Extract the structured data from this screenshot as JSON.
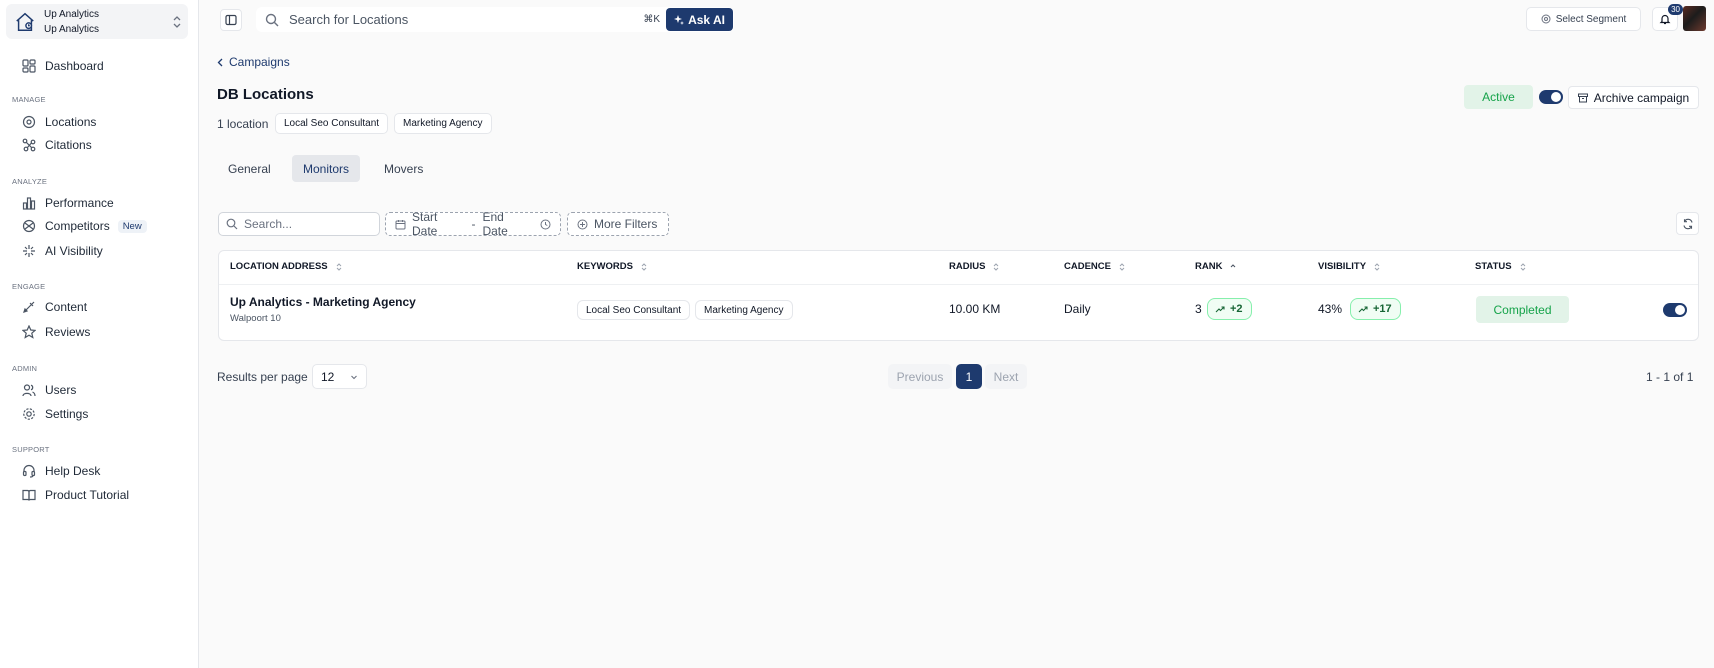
{
  "org": {
    "name": "Up Analytics",
    "subname": "Up Analytics"
  },
  "sidebar": {
    "dashboard": "Dashboard",
    "sections": {
      "manage": "MANAGE",
      "analyze": "ANALYZE",
      "engage": "ENGAGE",
      "admin": "ADMIN",
      "support": "SUPPORT"
    },
    "items": {
      "locations": "Locations",
      "citations": "Citations",
      "performance": "Performance",
      "competitors": "Competitors",
      "competitors_badge": "New",
      "ai_visibility": "AI Visibility",
      "content": "Content",
      "reviews": "Reviews",
      "users": "Users",
      "settings": "Settings",
      "help_desk": "Help Desk",
      "product_tutorial": "Product Tutorial"
    }
  },
  "topbar": {
    "search_placeholder": "Search for Locations",
    "shortcut": "⌘K",
    "ask_ai": "Ask AI",
    "select_segment": "Select Segment",
    "notification_count": "30"
  },
  "breadcrumb": {
    "back_label": "Campaigns"
  },
  "campaign": {
    "title": "DB Locations",
    "location_count": "1 location",
    "keywords": [
      "Local Seo Consultant",
      "Marketing Agency"
    ],
    "status": "Active",
    "archive_label": "Archive campaign"
  },
  "tabs": [
    "General",
    "Monitors",
    "Movers"
  ],
  "filters": {
    "search_placeholder": "Search...",
    "start_date": "Start Date",
    "date_sep": "-",
    "end_date": "End Date",
    "more_filters": "More Filters"
  },
  "table": {
    "headers": [
      "LOCATION ADDRESS",
      "KEYWORDS",
      "RADIUS",
      "CADENCE",
      "RANK",
      "VISIBILITY",
      "STATUS"
    ],
    "rows": [
      {
        "name": "Up Analytics - Marketing Agency",
        "address": "Walpoort 10",
        "keywords": [
          "Local Seo Consultant",
          "Marketing Agency"
        ],
        "radius": "10.00 KM",
        "cadence": "Daily",
        "rank": "3",
        "rank_change": "+2",
        "visibility": "43%",
        "visibility_change": "+17",
        "status": "Completed"
      }
    ]
  },
  "pagination": {
    "results_per_page_label": "Results per page",
    "per_page": "12",
    "previous": "Previous",
    "current": "1",
    "next": "Next",
    "range": "1 - 1 of 1"
  },
  "colors": {
    "brand": "#1e3a6e",
    "success_bg": "#e2f3e8",
    "success_text": "#16a34a"
  }
}
